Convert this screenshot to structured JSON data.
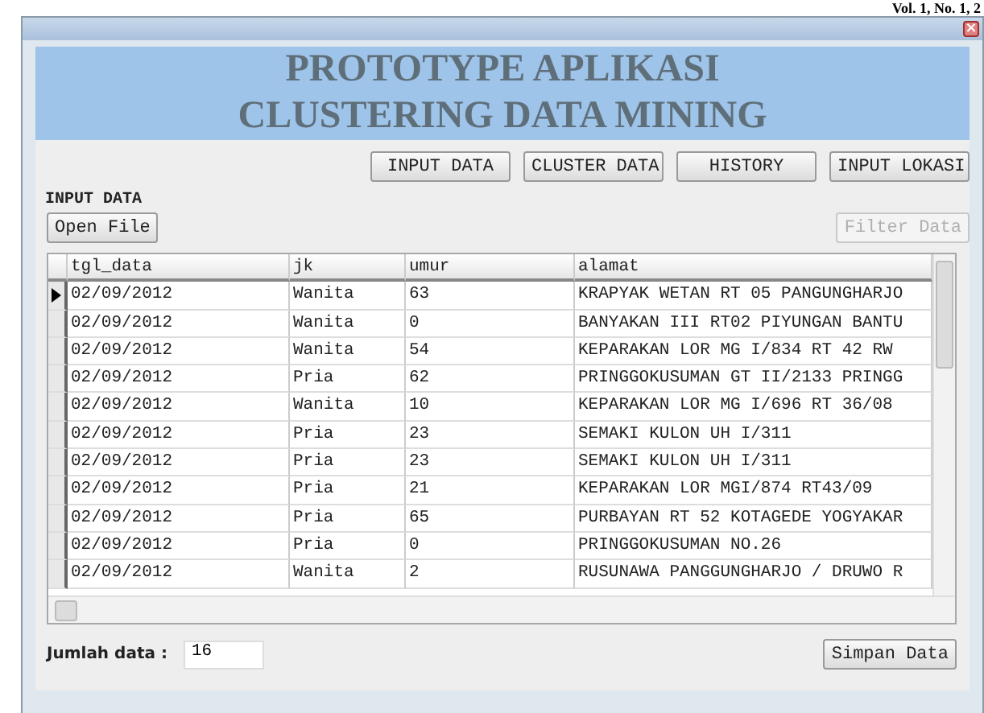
{
  "page_header": "Vol. 1, No. 1, 2",
  "window": {
    "close": "×",
    "title_lines": [
      "PROTOTYPE APLIKASI",
      "CLUSTERING DATA MINING"
    ]
  },
  "nav_buttons": [
    "INPUT DATA",
    "CLUSTER DATA",
    "HISTORY",
    "INPUT LOKASI"
  ],
  "section_label": "INPUT DATA",
  "open_button": "Open File",
  "filter_button": {
    "label": "Filter Data",
    "disabled": true
  },
  "table": {
    "columns": [
      "tgl_data",
      "jk",
      "umur",
      "alamat"
    ],
    "rows": [
      {
        "cells": [
          "02/09/2012",
          "Wanita",
          "63",
          "KRAPYAK WETAN RT 05 PANGUNGHARJO"
        ],
        "selected": true
      },
      {
        "cells": [
          "02/09/2012",
          "Wanita",
          "0",
          "BANYAKAN III RT02 PIYUNGAN BANTU"
        ],
        "selected": false
      },
      {
        "cells": [
          "02/09/2012",
          "Wanita",
          "54",
          "KEPARAKAN LOR MG I/834 RT 42 RW"
        ],
        "selected": false
      },
      {
        "cells": [
          "02/09/2012",
          "Pria",
          "62",
          "PRINGGOKUSUMAN GT II/2133 PRINGG"
        ],
        "selected": false
      },
      {
        "cells": [
          "02/09/2012",
          "Wanita",
          "10",
          "KEPARAKAN LOR MG I/696 RT 36/08"
        ],
        "selected": false
      },
      {
        "cells": [
          "02/09/2012",
          "Pria",
          "23",
          "SEMAKI KULON UH I/311"
        ],
        "selected": false
      },
      {
        "cells": [
          "02/09/2012",
          "Pria",
          "23",
          "SEMAKI KULON UH I/311"
        ],
        "selected": false
      },
      {
        "cells": [
          "02/09/2012",
          "Pria",
          "21",
          "KEPARAKAN LOR MGI/874 RT43/09"
        ],
        "selected": false
      },
      {
        "cells": [
          "02/09/2012",
          "Pria",
          "65",
          "PURBAYAN RT 52 KOTAGEDE YOGYAKAR"
        ],
        "selected": false
      },
      {
        "cells": [
          "02/09/2012",
          "Pria",
          "0",
          "PRINGGOKUSUMAN NO.26"
        ],
        "selected": false
      },
      {
        "cells": [
          "02/09/2012",
          "Wanita",
          "2",
          "RUSUNAWA PANGGUNGHARJO / DRUWO R"
        ],
        "selected": false
      }
    ]
  },
  "count_label": "Jumlah data :",
  "count_value": "16",
  "save_button": "Simpan Data"
}
